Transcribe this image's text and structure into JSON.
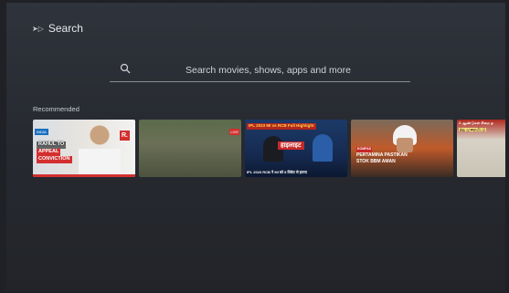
{
  "header": {
    "icon": "input-source-icon",
    "title": "Search"
  },
  "search": {
    "icon": "search-icon",
    "placeholder": "Search movies, shows, apps and more"
  },
  "recommended": {
    "title": "Recommended",
    "cards": [
      {
        "logo": "INDIA",
        "lines": [
          "RAHUL TO",
          "APPEAL",
          "CONVICTION"
        ],
        "badge": "R."
      },
      {
        "tag": "LIVE"
      },
      {
        "header": "IPL 2023 MI vs RCB Full Highlight",
        "title": "हाइलाइट",
        "caption": "IPL 2023 RCB ने MI को 8 विकेट से हराया"
      },
      {
        "tag": "KOMPAS",
        "lines": [
          "PERTAMINA PASTIKAN",
          "STOK BBM AMAN"
        ]
      },
      {
        "lines": [
          "2 ஆண்டுகள் சிறை த",
          "ந்து முறையீட்டு"
        ]
      }
    ]
  },
  "colors": {
    "background": "#2b2f36",
    "text": "#e8eaed",
    "accent_red": "#d32f2f"
  }
}
